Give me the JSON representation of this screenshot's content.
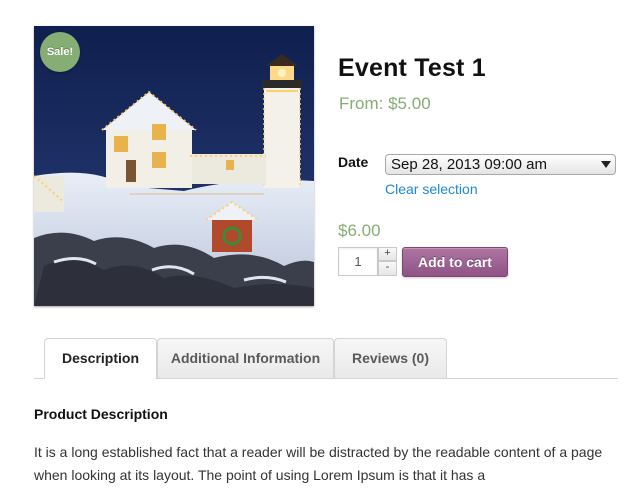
{
  "product": {
    "sale_badge": "Sale!",
    "title": "Event Test 1",
    "price_from": "From: $5.00",
    "image_alt": "Snow-covered lighthouse with holiday lights at night"
  },
  "variation": {
    "date_label": "Date",
    "date_selected": "Sep 28, 2013 09:00 am",
    "clear_selection": "Clear selection",
    "price": "$6.00"
  },
  "cart": {
    "quantity": "1",
    "plus_label": "+",
    "minus_label": "-",
    "add_to_cart_label": "Add to cart"
  },
  "tabs": [
    {
      "label": "Description",
      "active": true
    },
    {
      "label": "Additional Information",
      "active": false
    },
    {
      "label": "Reviews (0)",
      "active": false
    }
  ],
  "description": {
    "heading": "Product Description",
    "text": "It is a long established fact that a reader will be distracted by the readable content of a page when looking at its layout. The point of using Lorem Ipsum is that it has a"
  },
  "colors": {
    "price_green": "#85ad74",
    "button_purple": "#a46497",
    "link_blue": "#1e88d0"
  }
}
